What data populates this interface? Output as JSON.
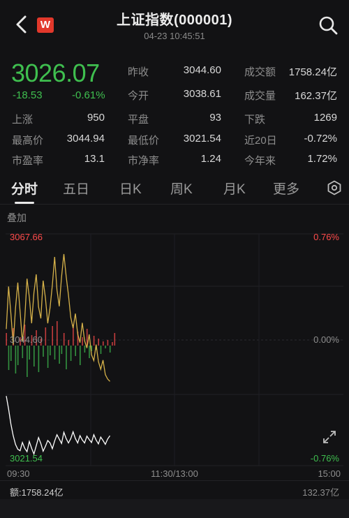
{
  "header": {
    "title": "上证指数(000001)",
    "datetime": "04-23 10:45:51",
    "logo_text": "W"
  },
  "quote": {
    "price": "3026.07",
    "change": "-18.53",
    "change_pct": "-0.61%",
    "stats": [
      {
        "label": "昨收",
        "value": "3044.60"
      },
      {
        "label": "成交额",
        "value": "1758.24亿"
      },
      {
        "label": "今开",
        "value": "3038.61"
      },
      {
        "label": "成交量",
        "value": "162.37亿"
      },
      {
        "label": "上涨",
        "value": "950"
      },
      {
        "label": "平盘",
        "value": "93"
      },
      {
        "label": "下跌",
        "value": "1269"
      },
      {
        "label": "最高价",
        "value": "3044.94"
      },
      {
        "label": "最低价",
        "value": "3021.54"
      },
      {
        "label": "近20日",
        "value": "-0.72%"
      },
      {
        "label": "市盈率",
        "value": "13.1"
      },
      {
        "label": "市净率",
        "value": "1.24"
      },
      {
        "label": "今年来",
        "value": "1.72%"
      }
    ]
  },
  "tabs": [
    "分时",
    "五日",
    "日K",
    "周K",
    "月K",
    "更多"
  ],
  "chart": {
    "overlay_label": "叠加",
    "y_max": "3067.66",
    "y_max_pct": "0.76%",
    "y_mid": "3044.60",
    "y_mid_pct": "0.00%",
    "y_min": "3021.54",
    "y_min_pct": "-0.76%",
    "time_start": "09:30",
    "time_mid": "11:30/13:00",
    "time_end": "15:00"
  },
  "footer": {
    "volume_label": "额:1758.24亿",
    "volume_max": "132.37亿"
  },
  "colors": {
    "up": "#ff4b4b",
    "down": "#3fbf4f",
    "price_line": "#ffffff",
    "avg_line": "#d6b24a"
  },
  "chart_data": {
    "type": "line",
    "x_range": [
      "09:30",
      "15:00"
    ],
    "ylim": [
      3021.54,
      3067.66
    ],
    "baseline": 3044.6,
    "series": [
      {
        "values": [
          3034.2,
          3031.5,
          3028.4,
          3026.0,
          3024.2,
          3023.2,
          3022.9,
          3024.6,
          3023.4,
          3022.7,
          3024.8,
          3023.4,
          3022.2,
          3023.9,
          3025.6,
          3024.4,
          3022.8,
          3023.8,
          3025.0,
          3024.5,
          3023.3,
          3024.9,
          3026.2,
          3025.3,
          3024.4,
          3026.7,
          3025.4,
          3024.5,
          3025.4,
          3026.8,
          3025.4,
          3024.5,
          3026.0,
          3025.1,
          3024.5,
          3025.9,
          3025.2,
          3024.6,
          3026.2,
          3025.1,
          3024.3,
          3025.7,
          3025.0,
          3024.2,
          3025.3,
          3026.0
        ]
      },
      {
        "values": [
          3048.0,
          3056.8,
          3051.2,
          3044.8,
          3052.3,
          3057.6,
          3051.6,
          3045.4,
          3050.0,
          3058.4,
          3054.6,
          3049.2,
          3055.5,
          3059.3,
          3052.6,
          3050.2,
          3058.0,
          3054.4,
          3049.2,
          3052.4,
          3057.1,
          3062.9,
          3056.1,
          3052.7,
          3058.8,
          3063.5,
          3058.9,
          3055.0,
          3050.4,
          3048.2,
          3051.2,
          3047.0,
          3045.2,
          3049.3,
          3045.6,
          3044.1,
          3046.9,
          3042.7,
          3041.5,
          3044.8,
          3041.3,
          3039.7,
          3041.6,
          3038.6,
          3037.7,
          3037.2
        ]
      }
    ]
  }
}
